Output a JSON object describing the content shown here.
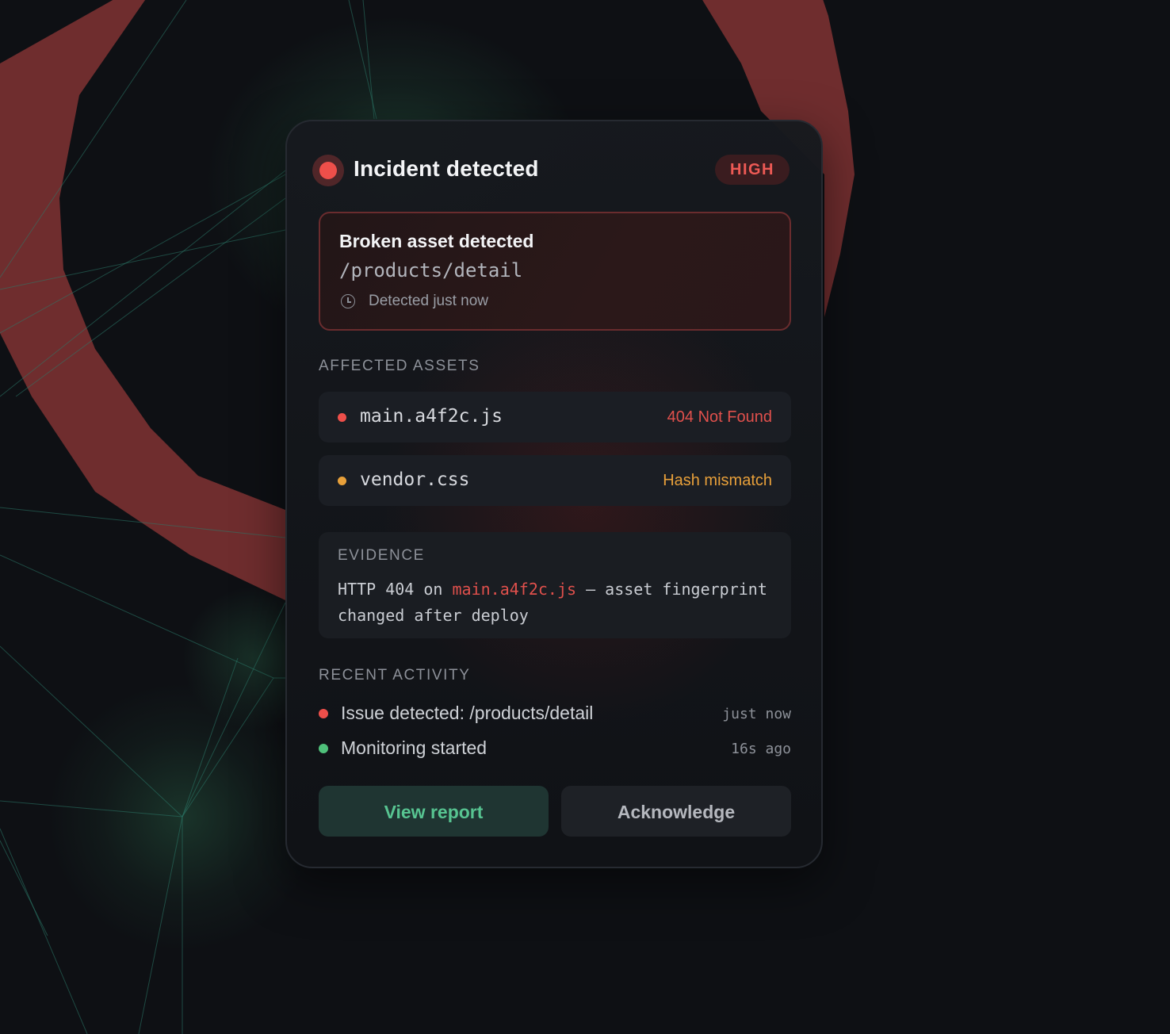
{
  "incident": {
    "title": "Incident detected",
    "severity": "HIGH"
  },
  "alert": {
    "title": "Broken asset detected",
    "path": "/products/detail",
    "time": "Detected just now",
    "icon": "clock-icon"
  },
  "affected_assets": {
    "label": "AFFECTED ASSETS",
    "items": [
      {
        "name": "main.a4f2c.js",
        "status": "404 Not Found",
        "color": "#e0504c"
      },
      {
        "name": "vendor.css",
        "status": "Hash mismatch",
        "color": "#e8a03a"
      }
    ]
  },
  "evidence": {
    "label": "EVIDENCE",
    "text_before": "HTTP 404 on ",
    "highlight": "main.a4f2c.js",
    "text_after": " — asset fingerprint changed after deploy"
  },
  "recent_activity": {
    "label": "RECENT ACTIVITY",
    "items": [
      {
        "text": "Issue detected: /products/detail",
        "time": "just now",
        "color": "#ee4f4a"
      },
      {
        "text": "Monitoring started",
        "time": "16s ago",
        "color": "#4fc07a"
      }
    ]
  },
  "actions": {
    "primary": "View report",
    "secondary": "Acknowledge"
  },
  "colors": {
    "accent_red": "#ee4f4a",
    "accent_green": "#57c491",
    "warning_orange": "#e8a03a",
    "background": "#0e1014"
  }
}
